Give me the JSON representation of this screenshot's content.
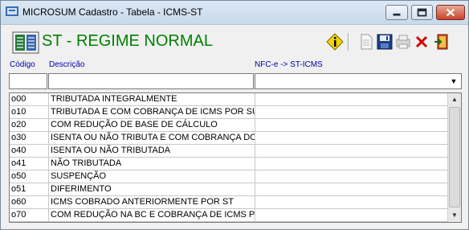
{
  "window": {
    "title": "MICROSUM Cadastro - Tabela - ICMS-ST"
  },
  "header": {
    "title": "ST - REGIME NORMAL"
  },
  "columns": {
    "codigo": "Código",
    "descricao": "Descrição",
    "nfce": "NFC-e -> ST-ICMS"
  },
  "filters": {
    "codigo": "",
    "descricao": "",
    "nfce": ""
  },
  "rows": [
    {
      "codigo": "o00",
      "descricao": "TRIBUTADA INTEGRALMENTE",
      "nfce": ""
    },
    {
      "codigo": "o10",
      "descricao": "TRIBUTADA E COM COBRANÇA DE ICMS POR SUI",
      "nfce": ""
    },
    {
      "codigo": "o20",
      "descricao": "COM REDUÇÃO DE BASE DE CÁLCULO",
      "nfce": ""
    },
    {
      "codigo": "o30",
      "descricao": "ISENTA OU NÃO TRIBUTA E COM COBRANÇA DO",
      "nfce": ""
    },
    {
      "codigo": "o40",
      "descricao": "ISENTA OU NÃO TRIBUTADA",
      "nfce": ""
    },
    {
      "codigo": "o41",
      "descricao": "NÃO TRIBUTADA",
      "nfce": ""
    },
    {
      "codigo": "o50",
      "descricao": "SUSPENÇÃO",
      "nfce": ""
    },
    {
      "codigo": "o51",
      "descricao": "DIFERIMENTO",
      "nfce": ""
    },
    {
      "codigo": "o60",
      "descricao": "ICMS COBRADO ANTERIORMENTE POR ST",
      "nfce": ""
    },
    {
      "codigo": "o70",
      "descricao": "COM REDUÇÃO NA BC E COBRANÇA DE ICMS POI",
      "nfce": ""
    }
  ],
  "colors": {
    "header_title": "#008000",
    "column_label": "#0000aa"
  }
}
